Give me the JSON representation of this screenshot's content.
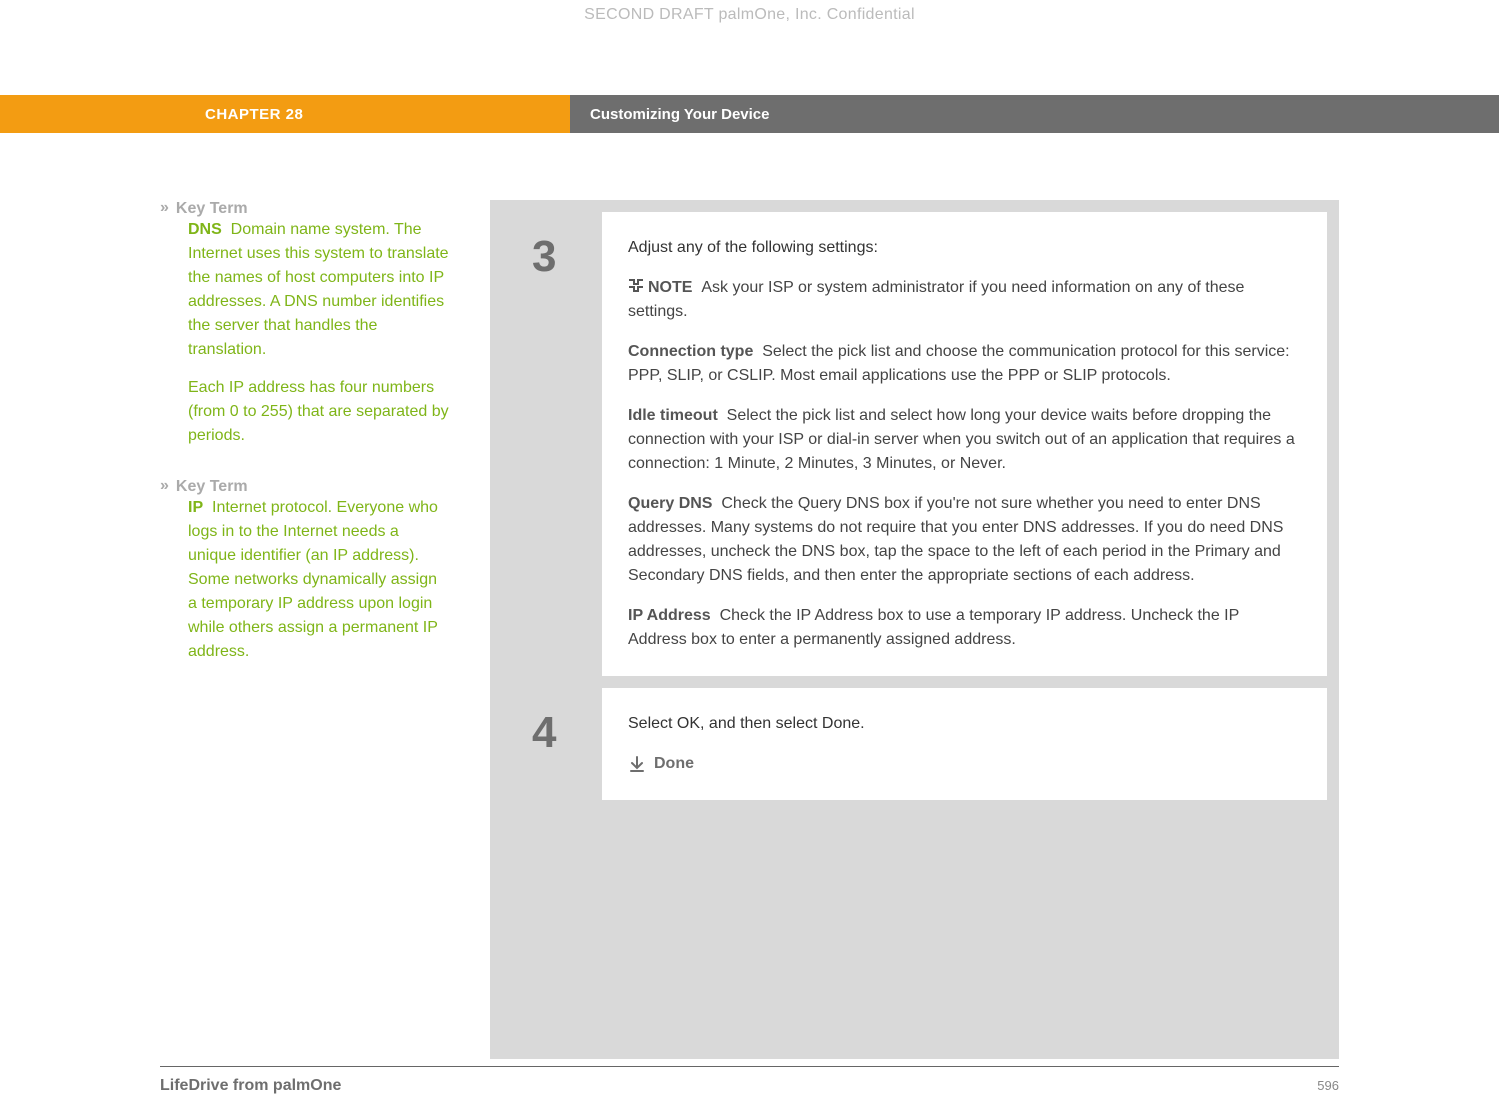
{
  "watermark": "SECOND DRAFT palmOne, Inc.  Confidential",
  "header": {
    "chapter": "CHAPTER 28",
    "title": "Customizing Your Device"
  },
  "sidebar": {
    "keyterms": [
      {
        "label": "Key Term",
        "term": "DNS",
        "body": "Domain name system. The Internet uses this system to translate the names of host computers into IP addresses. A DNS number identifies the server that handles the translation.",
        "extra": "Each IP address has four numbers (from 0 to 255) that are separated by periods."
      },
      {
        "label": "Key Term",
        "term": "IP",
        "body": "Internet protocol. Everyone who logs in to the Internet needs a unique identifier (an IP address). Some networks dynamically assign a temporary IP address upon login while others assign a permanent IP address.",
        "extra": ""
      }
    ]
  },
  "steps": [
    {
      "num": "3",
      "lead": "Adjust any of the following settings:",
      "note_label": "NOTE",
      "note_text": "Ask your ISP or system administrator if you need information on any of these settings.",
      "settings": [
        {
          "name": "Connection type",
          "desc": "Select the pick list and choose the communication protocol for this service: PPP, SLIP, or CSLIP. Most email applications use the PPP or SLIP protocols."
        },
        {
          "name": "Idle timeout",
          "desc": "Select the pick list and select how long your device waits before dropping the connection with your ISP or dial-in server when you switch out of an application that requires a connection: 1 Minute, 2 Minutes, 3 Minutes, or Never."
        },
        {
          "name": "Query DNS",
          "desc": "Check the Query DNS box if you're not sure whether you need to enter DNS addresses. Many systems do not require that you enter DNS addresses. If you do need DNS addresses, uncheck the DNS box, tap the space to the left of each period in the Primary and Secondary DNS fields, and then enter the appropriate sections of each address."
        },
        {
          "name": "IP Address",
          "desc": "Check the IP Address box to use a temporary IP address. Uncheck the IP Address box to enter a permanently assigned address."
        }
      ]
    },
    {
      "num": "4",
      "lead": "Select OK, and then select Done.",
      "done": "Done"
    }
  ],
  "footer": {
    "product": "LifeDrive from palmOne",
    "page": "596"
  }
}
